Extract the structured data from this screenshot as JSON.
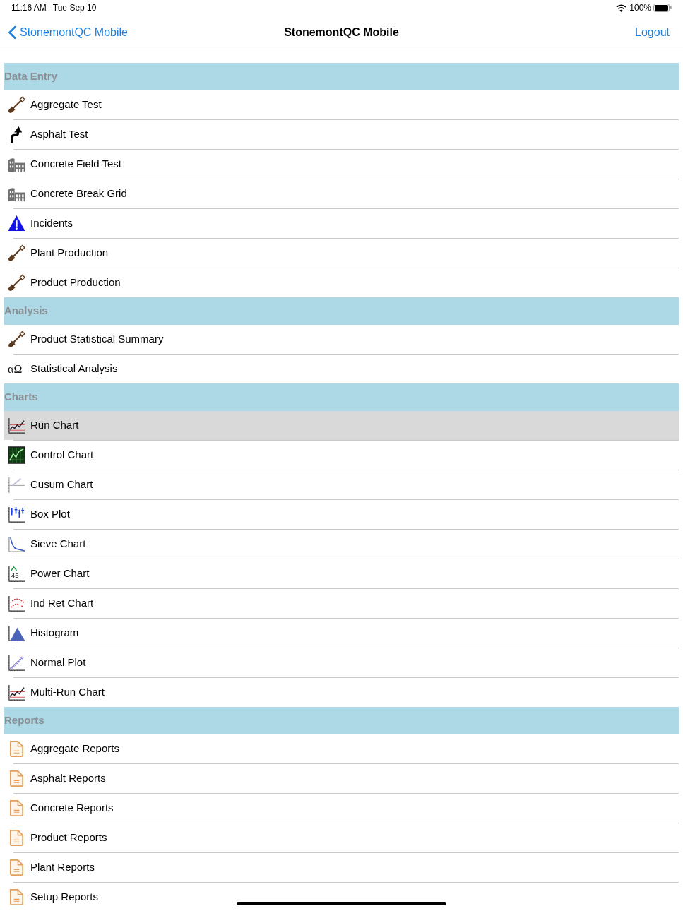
{
  "status_bar": {
    "time": "11:16 AM",
    "date": "Tue Sep 10",
    "battery": "100%"
  },
  "nav": {
    "back": "StonemontQC Mobile",
    "title": "StonemontQC Mobile",
    "action": "Logout"
  },
  "sections": [
    {
      "title": "Data Entry",
      "items": [
        {
          "label": "Aggregate Test",
          "kind": "shovel",
          "selected": false
        },
        {
          "label": "Asphalt Test",
          "kind": "turn",
          "selected": false
        },
        {
          "label": "Concrete Field Test",
          "kind": "building",
          "selected": false
        },
        {
          "label": "Concrete Break Grid",
          "kind": "building",
          "selected": false
        },
        {
          "label": "Incidents",
          "kind": "warning",
          "selected": false
        },
        {
          "label": "Plant Production",
          "kind": "shovel",
          "selected": false
        },
        {
          "label": "Product Production",
          "kind": "shovel",
          "selected": false
        }
      ]
    },
    {
      "title": "Analysis",
      "items": [
        {
          "label": "Product Statistical Summary",
          "kind": "shovel",
          "selected": false
        },
        {
          "label": "Statistical Analysis",
          "kind": "symbol",
          "icon_text": "αΩ",
          "selected": false
        }
      ]
    },
    {
      "title": "Charts",
      "items": [
        {
          "label": "Run Chart",
          "kind": "run",
          "selected": true
        },
        {
          "label": "Control Chart",
          "kind": "control",
          "selected": false
        },
        {
          "label": "Cusum Chart",
          "kind": "cusum",
          "selected": false
        },
        {
          "label": "Box Plot",
          "kind": "box",
          "selected": false
        },
        {
          "label": "Sieve Chart",
          "kind": "sieve",
          "selected": false
        },
        {
          "label": "Power Chart",
          "kind": "power",
          "icon_text": "45",
          "selected": false
        },
        {
          "label": "Ind Ret Chart",
          "kind": "indret",
          "selected": false
        },
        {
          "label": "Histogram",
          "kind": "histogram",
          "selected": false
        },
        {
          "label": "Normal Plot",
          "kind": "normal",
          "selected": false
        },
        {
          "label": "Multi-Run Chart",
          "kind": "run",
          "selected": false
        }
      ]
    },
    {
      "title": "Reports",
      "items": [
        {
          "label": "Aggregate Reports",
          "kind": "report",
          "selected": false
        },
        {
          "label": "Asphalt Reports",
          "kind": "report",
          "selected": false
        },
        {
          "label": "Concrete Reports",
          "kind": "report",
          "selected": false
        },
        {
          "label": "Product Reports",
          "kind": "report",
          "selected": false
        },
        {
          "label": "Plant Reports",
          "kind": "report",
          "selected": false
        },
        {
          "label": "Setup Reports",
          "kind": "report",
          "selected": false
        }
      ]
    }
  ]
}
